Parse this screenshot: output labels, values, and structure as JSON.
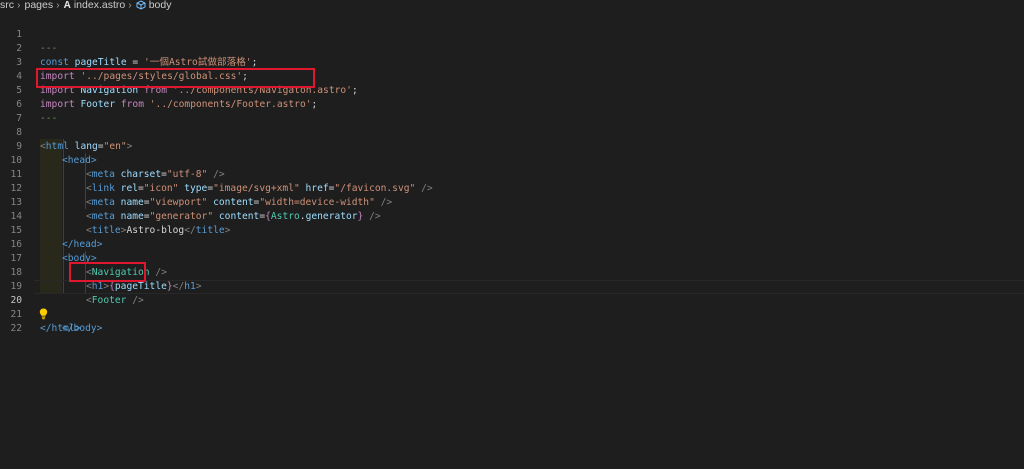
{
  "breadcrumb": {
    "src": "src",
    "pages": "pages",
    "astro_mark": "A",
    "file": "index.astro",
    "symbol": "body"
  },
  "editor": {
    "line_numbers": [
      "1",
      "2",
      "3",
      "4",
      "5",
      "6",
      "7",
      "8",
      "9",
      "10",
      "11",
      "12",
      "13",
      "14",
      "15",
      "16",
      "17",
      "18",
      "19",
      "20",
      "21",
      "22"
    ],
    "active_line": "20",
    "lines": {
      "l1": "---",
      "l2_kw": "const",
      "l2_var": "pageTitle",
      "l2_eq": " = ",
      "l2_str": "'一個Astro試做部落格'",
      "l2_end": ";",
      "l3_kw": "import",
      "l3_str": "'../pages/styles/global.css'",
      "l3_end": ";",
      "l4_kw": "import",
      "l4_var": "Navigation",
      "l4_from": "from",
      "l4_str": "'../components/Navigaton.astro'",
      "l4_end": ";",
      "l5_kw": "import",
      "l5_var": "Footer",
      "l5_from": "from",
      "l5_str": "'../components/Footer.astro'",
      "l5_end": ";",
      "l6": "---",
      "l8_open": "<",
      "l8_tag": "html",
      "l8_attr": "lang",
      "l8_eq": "=",
      "l8_val": "\"en\"",
      "l8_close": ">",
      "l9": "<head>",
      "l10_tag": "meta",
      "l10_attr": "charset",
      "l10_val": "\"utf-8\"",
      "l11_tag": "link",
      "l11_a1": "rel",
      "l11_v1": "\"icon\"",
      "l11_a2": "type",
      "l11_v2": "\"image/svg+xml\"",
      "l11_a3": "href",
      "l11_v3": "\"/favicon.svg\"",
      "l12_tag": "meta",
      "l12_a1": "name",
      "l12_v1": "\"viewport\"",
      "l12_a2": "content",
      "l12_v2": "\"width=device-width\"",
      "l13_tag": "meta",
      "l13_a1": "name",
      "l13_v1": "\"generator\"",
      "l13_a2": "content",
      "l13_expr": "Astro",
      "l13_prop": "generator",
      "l14_tag": "title",
      "l14_text": "Astro-blog",
      "l15": "</head>",
      "l16": "<body>",
      "l17_comp": "Navigation",
      "l18_tag": "h1",
      "l18_var": "pageTitle",
      "l19_comp": "Footer",
      "l20": "</body>",
      "l21": "</html>"
    }
  },
  "colors": {
    "highlight_box": "#e0182f",
    "lightbulb": "#ffcc00"
  },
  "icons": {
    "astro": "astro-file-icon",
    "symbol": "cube-symbol-icon",
    "bulb": "lightbulb-icon"
  }
}
